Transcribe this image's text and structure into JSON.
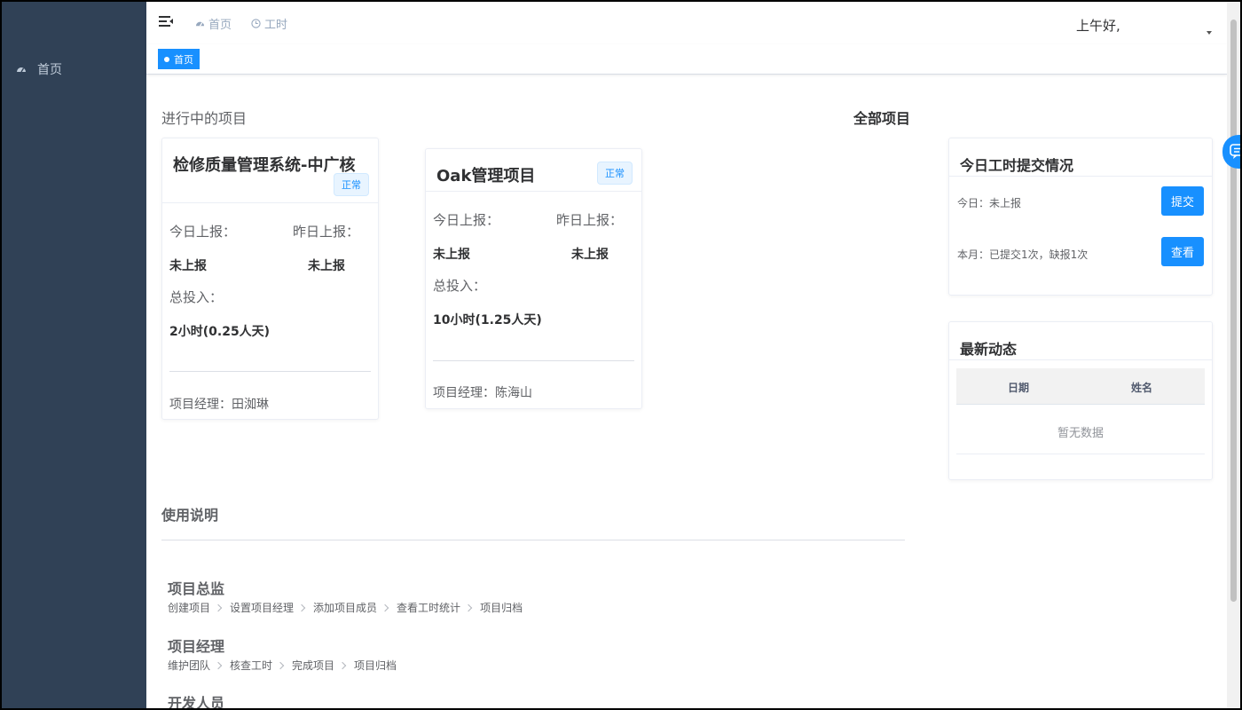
{
  "sidebar": {
    "items": [
      {
        "label": "首页",
        "icon": "dashboard-icon"
      }
    ]
  },
  "navbar": {
    "links": [
      {
        "label": "首页",
        "icon": "dashboard-icon"
      },
      {
        "label": "工时",
        "icon": "clock-icon"
      }
    ],
    "greeting": "上午好,"
  },
  "tags": [
    {
      "label": "首页",
      "active": true
    }
  ],
  "main": {
    "section_title": "进行中的项目",
    "all_projects": "全部项目",
    "projects": [
      {
        "title": "检修质量管理系统-中广核",
        "status": "正常",
        "today_label": "今日上报：",
        "today_value": "未上报",
        "yesterday_label": "昨日上报：",
        "yesterday_value": "未上报",
        "total_label": "总投入：",
        "total_value": "2小时(0.25人天)",
        "manager": "项目经理：田洳琳"
      },
      {
        "title": "Oak管理项目",
        "status": "正常",
        "today_label": "今日上报：",
        "today_value": "未上报",
        "yesterday_label": "昨日上报：",
        "yesterday_value": "未上报",
        "total_label": "总投入：",
        "total_value": "10小时(1.25人天)",
        "manager": "项目经理：陈海山"
      }
    ]
  },
  "worklog": {
    "title": "今日工时提交情况",
    "today_text": "今日：未上报",
    "submit_label": "提交",
    "month_text": "本月：已提交1次，缺报1次",
    "view_label": "查看"
  },
  "activity": {
    "title": "最新动态",
    "columns": [
      "日期",
      "姓名"
    ],
    "empty_text": "暂无数据"
  },
  "usage": {
    "title": "使用说明",
    "roles": [
      {
        "title": "项目总监",
        "steps": [
          "创建项目",
          "设置项目经理",
          "添加项目成员",
          "查看工时统计",
          "项目归档"
        ]
      },
      {
        "title": "项目经理",
        "steps": [
          "维护团队",
          "核查工时",
          "完成项目",
          "项目归档"
        ]
      },
      {
        "title": "开发人员",
        "steps": []
      }
    ]
  },
  "colors": {
    "sidebar_bg": "#304156",
    "primary": "#1890ff"
  }
}
